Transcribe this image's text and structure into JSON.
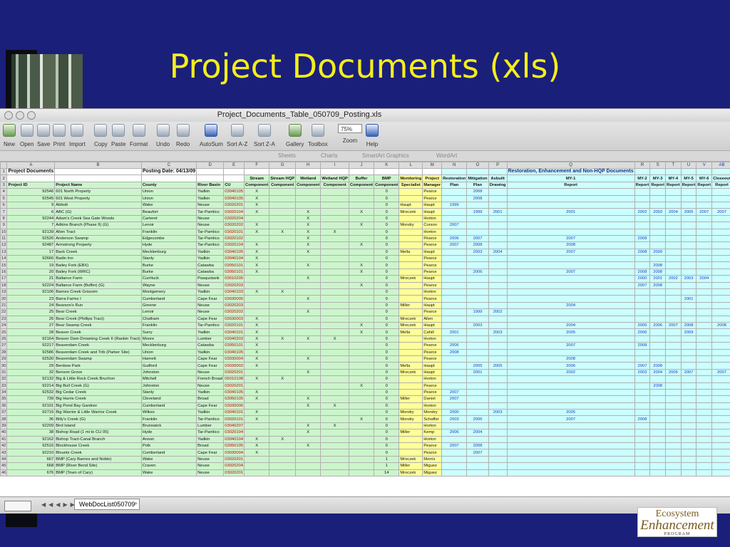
{
  "slide": {
    "title": "Project Documents (xls)"
  },
  "logo": {
    "line1": "Ecosystem",
    "line2": "Enhancement",
    "line3": "PROGRAM"
  },
  "window": {
    "title": "Project_Documents_Table_050709_Posting.xls"
  },
  "toolbar": [
    {
      "label": "New",
      "icon": "new-doc-icon"
    },
    {
      "label": "Open",
      "icon": "open-folder-icon"
    },
    {
      "label": "Save",
      "icon": "save-disk-icon"
    },
    {
      "label": "Print",
      "icon": "printer-icon"
    },
    {
      "label": "Import",
      "icon": "import-icon"
    },
    {
      "label": "Copy",
      "icon": "copy-icon"
    },
    {
      "label": "Paste",
      "icon": "paste-icon"
    },
    {
      "label": "Format",
      "icon": "format-brush-icon"
    },
    {
      "label": "Undo",
      "icon": "undo-icon"
    },
    {
      "label": "Redo",
      "icon": "redo-icon"
    },
    {
      "label": "AutoSum",
      "icon": "sigma-icon"
    },
    {
      "label": "Sort A-Z",
      "icon": "sort-az-icon"
    },
    {
      "label": "Sort Z-A",
      "icon": "sort-za-icon"
    },
    {
      "label": "Gallery",
      "icon": "gallery-icon"
    },
    {
      "label": "Toolbox",
      "icon": "toolbox-icon"
    },
    {
      "label": "Zoom",
      "icon": "zoom-icon",
      "value": "75%"
    },
    {
      "label": "Help",
      "icon": "help-icon"
    }
  ],
  "ribbon_tabs": [
    "Sheets",
    "Charts",
    "SmartArt Graphics",
    "WordArt"
  ],
  "columns": [
    "A",
    "B",
    "C",
    "D",
    "E",
    "F",
    "G",
    "H",
    "I",
    "J",
    "K",
    "L",
    "M",
    "N",
    "O",
    "P",
    "Q",
    "R",
    "S",
    "T",
    "U",
    "V",
    "AB"
  ],
  "header_rows": [
    [
      "Project Documents",
      "",
      "Posting Date: 04/13/09",
      "",
      "",
      "",
      "",
      "",
      "",
      "",
      "",
      "",
      "",
      "",
      "",
      "",
      "Restoration, Enhancement and Non-HQP Documents",
      "",
      "",
      "",
      "",
      "",
      ""
    ],
    [
      "",
      "",
      "",
      "",
      "",
      "Stream",
      "Stream HQP",
      "Wetland",
      "Wetland HQP",
      "Buffer",
      "BMP",
      "Monitoring",
      "Project",
      "Restoration",
      "Mitigation",
      "Asbuilt",
      "MY-1",
      "MY-2",
      "MY-3",
      "MY-4",
      "MY-5",
      "MY-6",
      "Closeout"
    ],
    [
      "Project ID",
      "Project Name",
      "County",
      "River Basin",
      "CU",
      "Component",
      "Component",
      "Component",
      "Component",
      "Component",
      "Component",
      "Specialist",
      "Manager",
      "Plan",
      "Plan",
      "Drawing",
      "Report",
      "Report",
      "Report",
      "Report",
      "Report",
      "Report",
      "Report"
    ]
  ],
  "rows": [
    [
      "92546",
      "601 North Property",
      "Union",
      "Yadkin",
      "03040105",
      "X",
      "",
      "",
      "",
      "",
      "0",
      "",
      "Pearce",
      "",
      "2008",
      "",
      "",
      "",
      "",
      "",
      "",
      "",
      ""
    ],
    [
      "92545",
      "601 West Property",
      "Union",
      "Yadkin",
      "03040105",
      "X",
      "",
      "",
      "",
      "",
      "0",
      "",
      "Pearce",
      "",
      "2008",
      "",
      "",
      "",
      "",
      "",
      "",
      "",
      ""
    ],
    [
      "9",
      "Abbott",
      "Wake",
      "Neuse",
      "03020201",
      "X",
      "",
      "",
      "",
      "",
      "0",
      "Haupt",
      "Haupt",
      "1999",
      "",
      "",
      "",
      "",
      "",
      "",
      "",
      "",
      ""
    ],
    [
      "6",
      "ABC (G)",
      "Beaufort",
      "Tar-Pamlico",
      "03020104",
      "X",
      "",
      "X",
      "",
      "X",
      "0",
      "Mroczek",
      "Haupt",
      "",
      "1999",
      "2001",
      "2001",
      "2002",
      "2003",
      "2004",
      "2005",
      "2007",
      "2007"
    ],
    [
      "92244",
      "Adam's Creek Sea Gate Woods",
      "Carteret",
      "Neuse",
      "03020204",
      "",
      "",
      "X",
      "",
      "",
      "0",
      "",
      "Horton",
      "",
      "",
      "",
      "",
      "",
      "",
      "",
      "",
      "",
      ""
    ],
    [
      "7",
      "Adkins Branch (Phase II) (G)",
      "Lenoir",
      "Neuse",
      "03020202",
      "X",
      "",
      "X",
      "",
      "X",
      "0",
      "Mondry",
      "Corson",
      "2007",
      "",
      "",
      "",
      "",
      "",
      "",
      "",
      "",
      ""
    ],
    [
      "92139",
      "Allen Tract",
      "Franklin",
      "Tar-Pamlico",
      "03020101",
      "X",
      "X",
      "X",
      "X",
      "",
      "0",
      "",
      "Horton",
      "",
      "",
      "",
      "",
      "",
      "",
      "",
      "",
      "",
      ""
    ],
    [
      "92526",
      "Anderson Swamp",
      "Edgecombe",
      "Tar-Pamlico",
      "03020102",
      "",
      "",
      "X",
      "",
      "",
      "0",
      "",
      "Pearce",
      "2006",
      "2007",
      "",
      "2007",
      "2008",
      "",
      "",
      "",
      "",
      ""
    ],
    [
      "92487",
      "Armstrong Property",
      "Hyde",
      "Tar-Pamlico",
      "03020104",
      "X",
      "",
      "X",
      "",
      "X",
      "0",
      "",
      "Pearce",
      "2007",
      "2008",
      "",
      "2008",
      "",
      "",
      "",
      "",
      "",
      ""
    ],
    [
      "17",
      "Back Creek",
      "Mecklenburg",
      "Yadkin",
      "03040105",
      "X",
      "",
      "X",
      "",
      "",
      "0",
      "Mella",
      "Haupt",
      "",
      "2003",
      "2004",
      "2007",
      "2008",
      "2009",
      "",
      "",
      "",
      ""
    ],
    [
      "92666",
      "Badin Inn",
      "Stanly",
      "Yadkin",
      "03040104",
      "X",
      "",
      "",
      "",
      "",
      "0",
      "",
      "Pearce",
      "",
      "",
      "",
      "",
      "",
      "",
      "",
      "",
      "",
      ""
    ],
    [
      "19",
      "Bailey Fork (EBX)",
      "Burke",
      "Catawba",
      "03050101",
      "X",
      "",
      "X",
      "",
      "X",
      "0",
      "",
      "Pearce",
      "",
      "",
      "",
      "",
      "",
      "2008",
      "",
      "",
      "",
      ""
    ],
    [
      "20",
      "Bailey Fork (WRC)",
      "Burke",
      "Catawba",
      "03050101",
      "X",
      "",
      "",
      "",
      "X",
      "0",
      "",
      "Pearce",
      "",
      "2006",
      "",
      "2007",
      "2008",
      "2008",
      "",
      "",
      "",
      ""
    ],
    [
      "21",
      "Ballance Farm",
      "Currituck",
      "Pasquotank",
      "03010205",
      "",
      "",
      "X",
      "",
      "",
      "0",
      "Mroczek",
      "Haupt",
      "",
      "",
      "",
      "",
      "2000",
      "2001",
      "2002",
      "2003",
      "2004",
      ""
    ],
    [
      "92224",
      "Ballance Farm (Buffer) (G)",
      "Wayne",
      "Neuse",
      "03020203",
      "",
      "",
      "",
      "",
      "X",
      "0",
      "",
      "Pearce",
      "",
      "",
      "",
      "",
      "2007",
      "2008",
      "",
      "",
      "",
      ""
    ],
    [
      "92106",
      "Barnes Creek Grissom",
      "Montgomery",
      "Yadkin",
      "03040103",
      "X",
      "X",
      "",
      "",
      "",
      "0",
      "",
      "Horton",
      "",
      "",
      "",
      "",
      "",
      "",
      "",
      "",
      "",
      ""
    ],
    [
      "23",
      "Barra Farms I",
      "Cumberland",
      "Cape Fear",
      "03030005",
      "",
      "",
      "X",
      "",
      "",
      "0",
      "",
      "Pearce",
      "",
      "",
      "",
      "",
      "",
      "",
      "",
      "2001",
      "",
      ""
    ],
    [
      "24",
      "Bearson's Run",
      "Greene",
      "Neuse",
      "03020203",
      "",
      "",
      "",
      "",
      "",
      "0",
      "Miller",
      "Haupt",
      "",
      "",
      "",
      "2004",
      "",
      "",
      "",
      "",
      "",
      ""
    ],
    [
      "25",
      "Bear Creek",
      "Lenoir",
      "Neuse",
      "03020202",
      "",
      "",
      "X",
      "",
      "",
      "0",
      "",
      "Pearce",
      "",
      "1999",
      "2002",
      "",
      "",
      "",
      "",
      "",
      "",
      ""
    ],
    [
      "26",
      "Bear Creek (Phillips Tract)",
      "Chatham",
      "Cape Fear",
      "03030003",
      "X",
      "",
      "",
      "",
      "",
      "0",
      "Mroczek",
      "Allen",
      "",
      "",
      "",
      "",
      "",
      "",
      "",
      "",
      "",
      ""
    ],
    [
      "27",
      "Bear Swamp Creek",
      "Franklin",
      "Tar-Pamlico",
      "03020101",
      "X",
      "",
      "",
      "",
      "X",
      "0",
      "Mroczek",
      "Haupt",
      "",
      "2003",
      "",
      "2004",
      "2005",
      "2006",
      "2007",
      "2008",
      "",
      "2008"
    ],
    [
      "28",
      "Beaver Creek",
      "Surry",
      "Yadkin",
      "03040101",
      "X",
      "",
      "",
      "",
      "X",
      "0",
      "Mella",
      "Cahill",
      "2001",
      "",
      "2003",
      "2005",
      "2006",
      "",
      "",
      "2009",
      "",
      ""
    ],
    [
      "92164",
      "Beaver Dam-Drowning Creek II (Rankin Tract)",
      "Moore",
      "Lumber",
      "03040203",
      "X",
      "X",
      "X",
      "X",
      "",
      "0",
      "",
      "Horton",
      "",
      "",
      "",
      "",
      "",
      "",
      "",
      "",
      "",
      ""
    ],
    [
      "92217",
      "Beaverdam Creek",
      "Mecklenburg",
      "Catawba",
      "03050101",
      "X",
      "",
      "",
      "",
      "",
      "0",
      "",
      "Pearce",
      "2006",
      "",
      "",
      "2007",
      "2008",
      "",
      "",
      "",
      "",
      ""
    ],
    [
      "92586",
      "Beaverdam Creek and Trib (Parker Site)",
      "Union",
      "Yadkin",
      "03040105",
      "X",
      "",
      "",
      "",
      "",
      "0",
      "",
      "Pearce",
      "2008",
      "",
      "",
      "",
      "",
      "",
      "",
      "",
      "",
      ""
    ],
    [
      "92530",
      "Beaverdam Swamp",
      "Harnett",
      "Cape Fear",
      "03030004",
      "X",
      "",
      "X",
      "",
      "",
      "0",
      "",
      "Pearce",
      "",
      "",
      "",
      "2008",
      "",
      "",
      "",
      "",
      "",
      ""
    ],
    [
      "29",
      "Benbow Park",
      "Guilford",
      "Cape Fear",
      "03030002",
      "X",
      "",
      "",
      "",
      "",
      "0",
      "Mella",
      "Haupt",
      "",
      "2005",
      "2005",
      "2006",
      "2007",
      "2008",
      "",
      "",
      "",
      ""
    ],
    [
      "32",
      "Benson Grove",
      "Johnston",
      "Neuse",
      "03020201",
      "",
      "",
      "X",
      "",
      "",
      "0",
      "Mroczek",
      "Haupt",
      "",
      "2001",
      "",
      "2002",
      "2003",
      "2004",
      "2006",
      "2007",
      "",
      "2007"
    ],
    [
      "92132",
      "Big & Little Rock Creek Bruchon",
      "Mitchell",
      "French Broad",
      "06010108",
      "X",
      "X",
      "",
      "",
      "",
      "0",
      "",
      "Horton",
      "",
      "",
      "",
      "",
      "",
      "",
      "",
      "",
      "",
      ""
    ],
    [
      "92214",
      "Big Bull Creek (G)",
      "Johnston",
      "Neuse",
      "03020201",
      "",
      "",
      "",
      "",
      "X",
      "0",
      "",
      "Pearce",
      "",
      "",
      "",
      "",
      "",
      "2008",
      "",
      "",
      "",
      ""
    ],
    [
      "92532",
      "Big Cedar Creek",
      "Stanly",
      "Yadkin",
      "03040105",
      "X",
      "",
      "",
      "",
      "",
      "0",
      "",
      "Pearce",
      "2007",
      "",
      "",
      "",
      "",
      "",
      "",
      "",
      "",
      ""
    ],
    [
      "739",
      "Big Harris Creek",
      "Cleveland",
      "Broad",
      "03050105",
      "X",
      "",
      "X",
      "",
      "",
      "0",
      "Miller",
      "Daniel",
      "2007",
      "",
      "",
      "",
      "",
      "",
      "",
      "",
      "",
      ""
    ],
    [
      "92101",
      "Big Pond Bay Gardner",
      "Cumberland",
      "Cape Fear",
      "03030006",
      "",
      "",
      "X",
      "X",
      "",
      "0",
      "",
      "Horton",
      "",
      "",
      "",
      "",
      "",
      "",
      "",
      "",
      "",
      ""
    ],
    [
      "92716",
      "Big Warrior & Little Warrior Creek",
      "Wilkes",
      "Yadkin",
      "03040101",
      "X",
      "",
      "",
      "",
      "",
      "0",
      "Mondry",
      "Mondry",
      "2000",
      "",
      "2003",
      "2005",
      "",
      "",
      "",
      "",
      "",
      ""
    ],
    [
      "36",
      "Billy's Creek (G)",
      "Franklin",
      "Tar-Pamlico",
      "03020101",
      "X",
      "",
      "",
      "",
      "X",
      "0",
      "Mondry",
      "Schaffer",
      "2003",
      "2006",
      "",
      "2007",
      "2008",
      "",
      "",
      "",
      "",
      ""
    ],
    [
      "92209",
      "Bird Island",
      "Brunswick",
      "Lumber",
      "03040207",
      "",
      "",
      "X",
      "X",
      "",
      "0",
      "",
      "Horton",
      "",
      "",
      "",
      "",
      "",
      "",
      "",
      "",
      "",
      ""
    ],
    [
      "38",
      "Bishop Road (1 mi to CU 05)",
      "Hyde",
      "Tar-Pamlico",
      "03020104",
      "",
      "",
      "X",
      "",
      "",
      "0",
      "Miller",
      "Kemp",
      "2006",
      "2004",
      "",
      "",
      "",
      "",
      "",
      "",
      "",
      ""
    ],
    [
      "92162",
      "Bishop Tract-Canal Branch",
      "Anson",
      "Yadkin",
      "03040104",
      "X",
      "X",
      "",
      "",
      "",
      "0",
      "",
      "Horton",
      "",
      "",
      "",
      "",
      "",
      "",
      "",
      "",
      "",
      ""
    ],
    [
      "92516",
      "Blockhouse Creek",
      "Polk",
      "Broad",
      "03050105",
      "X",
      "",
      "X",
      "",
      "",
      "0",
      "",
      "Pearce",
      "2007",
      "2008",
      "",
      "",
      "",
      "",
      "",
      "",
      "",
      ""
    ],
    [
      "92210",
      "Blounts Creek",
      "Cumberland",
      "Cape Fear",
      "03030004",
      "X",
      "",
      "",
      "",
      "",
      "0",
      "",
      "Pearce",
      "",
      "2007",
      "",
      "",
      "",
      "",
      "",
      "",
      "",
      ""
    ],
    [
      "667",
      "BMP (Cary Barnes and Noble)",
      "Wake",
      "Neuse",
      "03020201",
      "",
      "",
      "",
      "",
      "",
      "1",
      "Mroczek",
      "Morris",
      "",
      "",
      "",
      "",
      "",
      "",
      "",
      "",
      "",
      ""
    ],
    [
      "668",
      "BMP (River Bend Site)",
      "Craven",
      "Neuse",
      "03020204",
      "",
      "",
      "",
      "",
      "",
      "1",
      "Miller",
      "Miguez",
      "",
      "",
      "",
      "",
      "",
      "",
      "",
      "",
      "",
      ""
    ],
    [
      "676",
      "BMP (Town of Cary)",
      "Wake",
      "Neuse",
      "03020201",
      "",
      "",
      "",
      "",
      "",
      "14",
      "Mroczek",
      "Miguez",
      "",
      "",
      "",
      "",
      "",
      "",
      "",
      "",
      "",
      ""
    ]
  ],
  "sheet_tab": "WebDocList050709"
}
